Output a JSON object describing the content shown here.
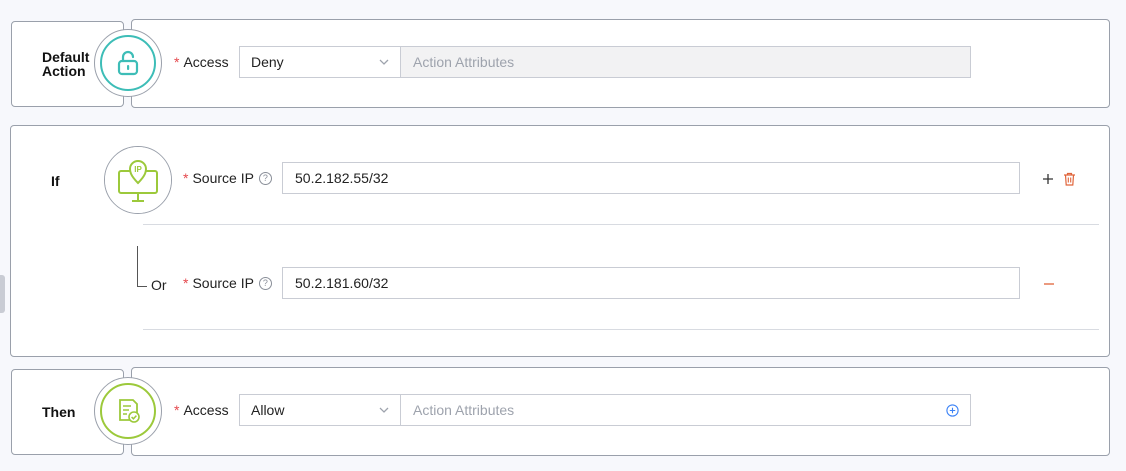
{
  "default_action": {
    "label": "Default Action",
    "access_label": "Access",
    "access_value": "Deny",
    "attributes_placeholder": "Action Attributes",
    "icon": "unlock-icon"
  },
  "if_block": {
    "label": "If",
    "icon": "monitor-ip-icon",
    "conditions": [
      {
        "field_label": "Source IP",
        "help": "?",
        "value": "50.2.182.55/32"
      },
      {
        "connector": "Or",
        "field_label": "Source IP",
        "help": "?",
        "value": "50.2.181.60/32"
      }
    ]
  },
  "then_block": {
    "label": "Then",
    "access_label": "Access",
    "access_value": "Allow",
    "attributes_placeholder": "Action Attributes",
    "icon": "checklist-icon"
  },
  "colors": {
    "teal": "#3dbdb7",
    "green": "#9cc93b",
    "danger": "#e0643a",
    "link": "#3b82f6"
  }
}
